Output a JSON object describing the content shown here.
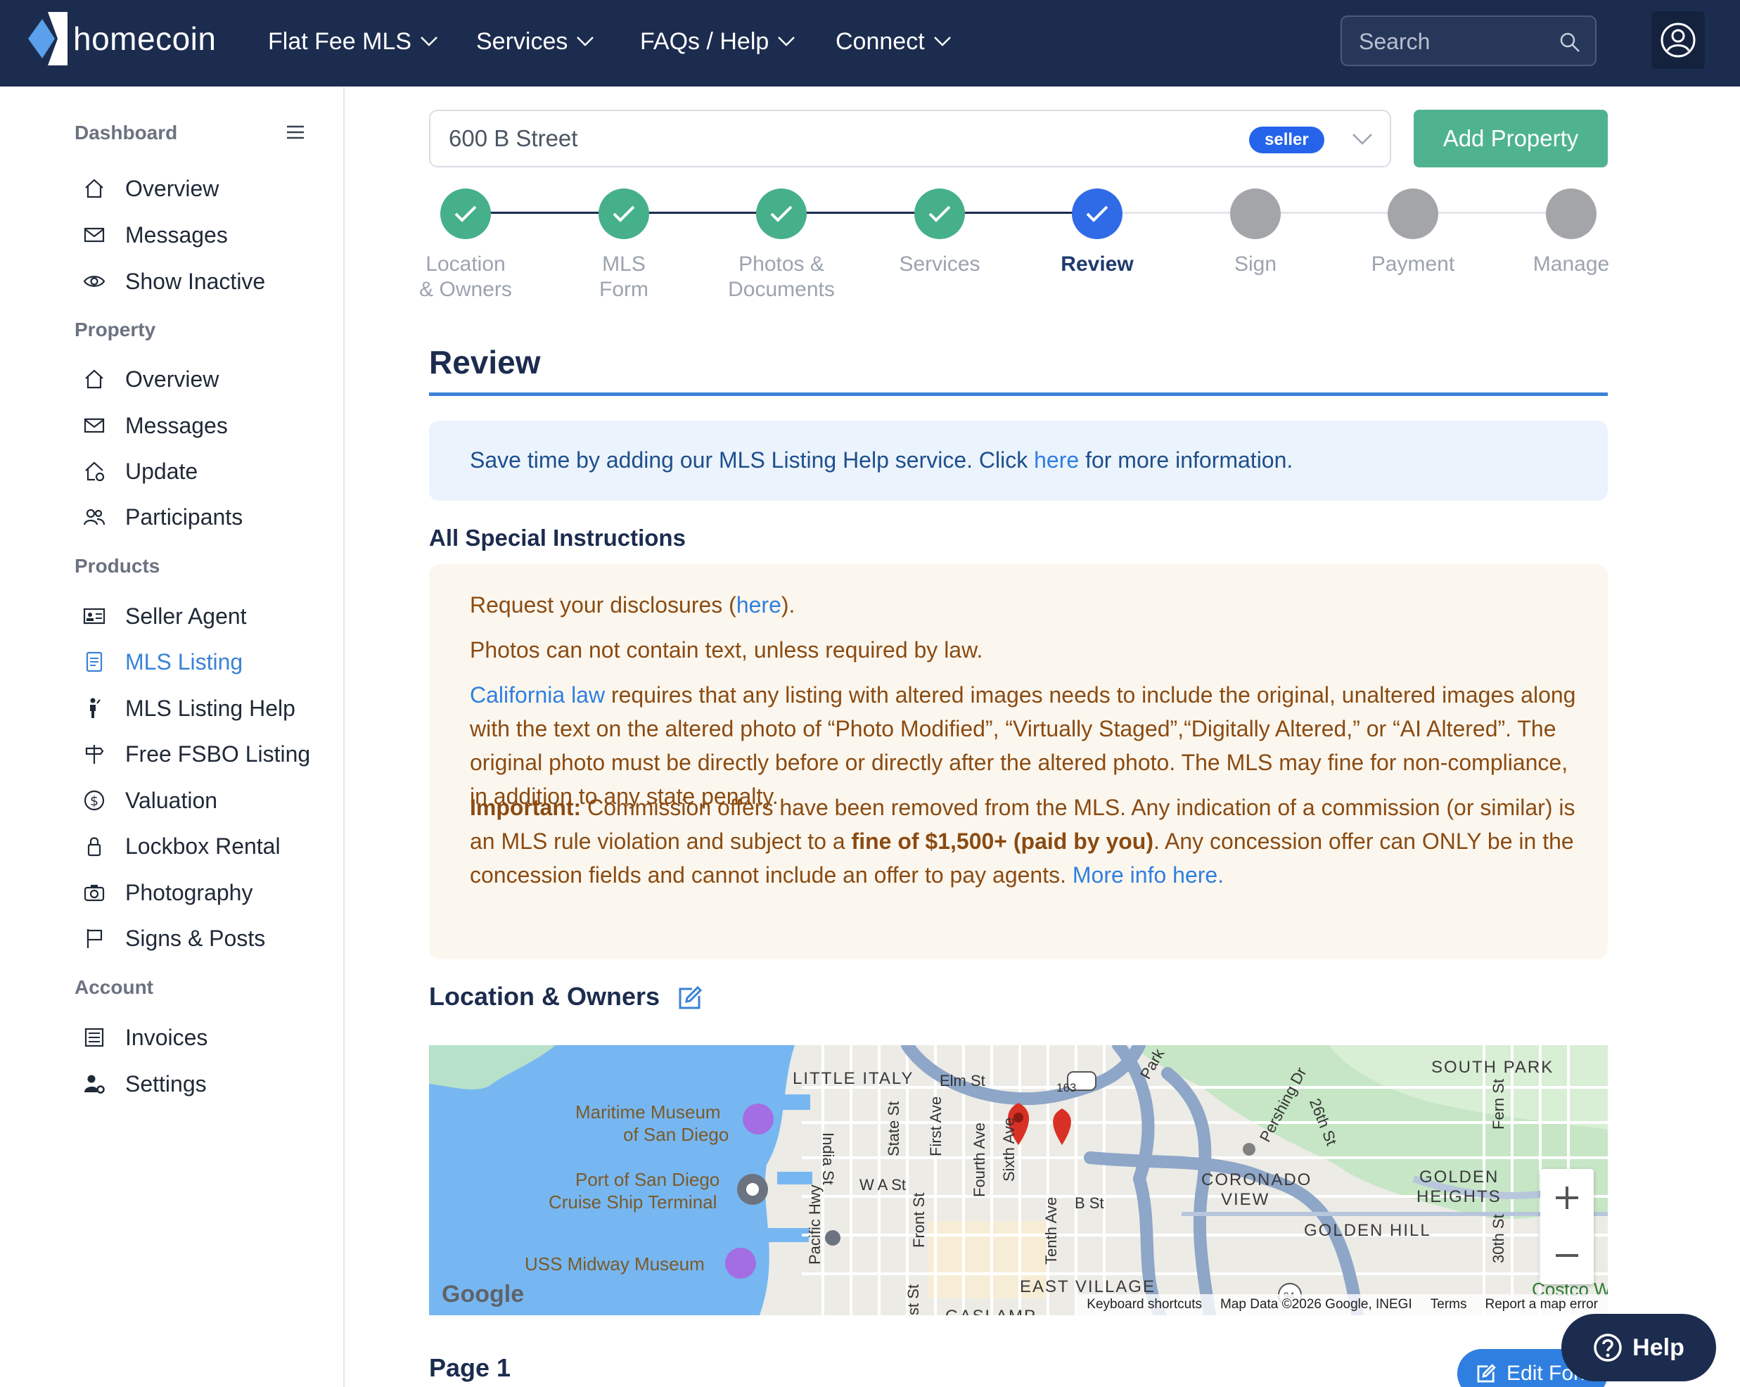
{
  "brand": {
    "name": "homecoin"
  },
  "nav": {
    "items": [
      {
        "label": "Flat Fee MLS"
      },
      {
        "label": "Services"
      },
      {
        "label": "FAQs / Help"
      },
      {
        "label": "Connect"
      }
    ],
    "search_placeholder": "Search"
  },
  "sidebar": {
    "dashboard": {
      "heading": "Dashboard",
      "items": [
        {
          "label": "Overview",
          "icon": "home-icon"
        },
        {
          "label": "Messages",
          "icon": "envelope-icon"
        },
        {
          "label": "Show Inactive",
          "icon": "eye-icon"
        }
      ]
    },
    "property": {
      "heading": "Property",
      "items": [
        {
          "label": "Overview",
          "icon": "home-icon"
        },
        {
          "label": "Messages",
          "icon": "envelope-icon"
        },
        {
          "label": "Update",
          "icon": "home-refresh-icon"
        },
        {
          "label": "Participants",
          "icon": "users-icon"
        }
      ]
    },
    "products": {
      "heading": "Products",
      "items": [
        {
          "label": "Seller Agent",
          "icon": "id-card-icon"
        },
        {
          "label": "MLS Listing",
          "icon": "document-icon",
          "active": true
        },
        {
          "label": "MLS Listing Help",
          "icon": "person-icon"
        },
        {
          "label": "Free FSBO Listing",
          "icon": "signpost-icon"
        },
        {
          "label": "Valuation",
          "icon": "dollar-circle-icon"
        },
        {
          "label": "Lockbox Rental",
          "icon": "lock-icon"
        },
        {
          "label": "Photography",
          "icon": "camera-icon"
        },
        {
          "label": "Signs & Posts",
          "icon": "flag-icon"
        }
      ]
    },
    "account": {
      "heading": "Account",
      "items": [
        {
          "label": "Invoices",
          "icon": "list-icon"
        },
        {
          "label": "Settings",
          "icon": "user-gear-icon"
        }
      ]
    }
  },
  "property_select": {
    "value": "600 B Street",
    "badge": "seller"
  },
  "add_property_label": "Add Property",
  "steps": [
    {
      "line1": "Location",
      "line2": "& Owners",
      "state": "done"
    },
    {
      "line1": "MLS",
      "line2": "Form",
      "state": "done"
    },
    {
      "line1": "Photos &",
      "line2": "Documents",
      "state": "done"
    },
    {
      "line1": "Services",
      "line2": "",
      "state": "done"
    },
    {
      "line1": "Review",
      "line2": "",
      "state": "current"
    },
    {
      "line1": "Sign",
      "line2": "",
      "state": "todo"
    },
    {
      "line1": "Payment",
      "line2": "",
      "state": "todo"
    },
    {
      "line1": "Manage",
      "line2": "",
      "state": "todo"
    }
  ],
  "review": {
    "title": "Review",
    "banner": {
      "prefix": "Save time by adding our MLS Listing Help service. Click ",
      "link": "here",
      "suffix": " for more information."
    }
  },
  "special": {
    "title": "All Special Instructions",
    "p1_prefix": "Request your disclosures (",
    "p1_link": "here",
    "p1_suffix": ").",
    "p2": "Photos can not contain text, unless required by law.",
    "p3_link": "California law",
    "p3_text": " requires that any listing with altered images needs to include the original, unaltered images along with the text on the altered photo of “Photo Modified”, “Virtually Staged”,“Digitally Altered,” or “AI Altered”. The original photo must be directly before or directly after the altered photo. The MLS may fine for non-compliance, in addition to any state penalty.",
    "p4_bold": "Important:",
    "p4_text1": " Commission offers have been removed from the MLS. Any indication of a commission (or similar) is an MLS rule violation and subject to a ",
    "p4_bold2": "fine of $1,500+ (paid by you)",
    "p4_text2": ". Any concession offer can ONLY be in the concession fields and cannot include an offer to pay agents. ",
    "p4_link": "More info here."
  },
  "location": {
    "title": "Location & Owners",
    "map": {
      "areas": [
        "LITTLE ITALY",
        "SOUTH PARK",
        "CORONADO",
        "VIEW",
        "GOLDEN",
        "HEIGHTS",
        "GOLDEN HILL",
        "EAST VILLAGE",
        "GASLAMP"
      ],
      "streets": [
        "Elm St",
        "India St",
        "State St",
        "First Ave",
        "Fourth Ave",
        "Sixth Ave",
        "W A St",
        "B St",
        "Front St",
        "Tenth Ave",
        "Pacific Hwy",
        "Pershing Dr",
        "26th St",
        "Fern St",
        "30th St",
        "Park",
        "st St",
        "163",
        "94"
      ],
      "pois": [
        "Maritime Museum",
        "of San Diego",
        "Port of San Diego",
        "Cruise Ship Terminal",
        "USS Midway Museum",
        "Costco W"
      ],
      "footer": [
        "Keyboard shortcuts",
        "Map Data ©2026 Google, INEGI",
        "Terms",
        "Report a map error"
      ],
      "logo": "Google",
      "zoom_in": "+",
      "zoom_out": "−"
    }
  },
  "page1": {
    "title": "Page 1",
    "edit_label": "Edit Form"
  },
  "help_label": "Help"
}
